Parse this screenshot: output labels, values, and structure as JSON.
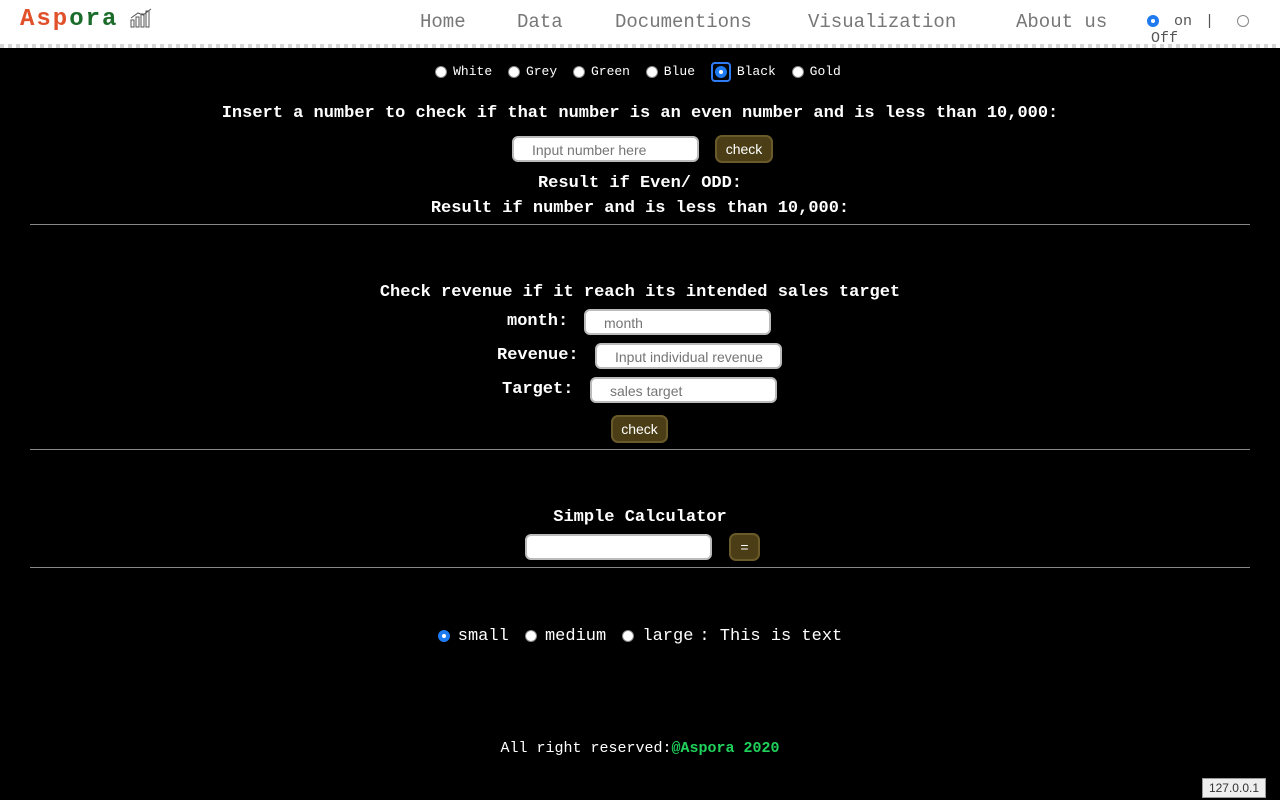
{
  "header": {
    "logo_a": "Asp",
    "logo_b": "ora",
    "nav": [
      "Home",
      "Data",
      "Documentions",
      "Visualization",
      "About us"
    ],
    "toggle_on": "on",
    "toggle_sep": "|",
    "toggle_off": "Off"
  },
  "themes": {
    "options": [
      "White",
      "Grey",
      "Green",
      "Blue",
      "Black",
      "Gold"
    ],
    "selected": "Black"
  },
  "even_check": {
    "question": "Insert a number to check if that number is an even number and is less than 10,000:",
    "placeholder": "Input number here",
    "button": "check",
    "result1": "Result if Even/ ODD:",
    "result2": "Result if number and is less than 10,000:"
  },
  "revenue": {
    "title": "Check revenue if it reach its intended sales target",
    "month_label": "month:",
    "month_placeholder": "month",
    "revenue_label": "Revenue:",
    "revenue_placeholder": "Input individual revenue",
    "target_label": "Target:",
    "target_placeholder": "sales target",
    "button": "check"
  },
  "calculator": {
    "title": "Simple Calculator",
    "button": "="
  },
  "text_size": {
    "options": [
      "small",
      "medium",
      "large"
    ],
    "selected": "small",
    "sample": ": This is text"
  },
  "footer": {
    "text": "All right reserved:",
    "brand": "@Aspora 2020"
  },
  "host_badge": "127.0.0.1",
  "colors": {
    "accent_button": "#4b3e16",
    "footer_brand": "#1fd35a",
    "logo_orange": "#e0502a",
    "logo_green": "#1b6b2b"
  }
}
